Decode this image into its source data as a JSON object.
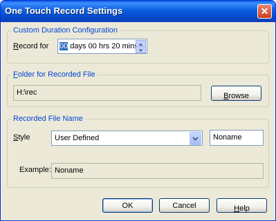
{
  "window": {
    "title": "One Touch Record Settings"
  },
  "duration_group": {
    "legend": "Custom Duration Configuration",
    "record_label_prefix": "R",
    "record_label_rest": "ecord for",
    "value_selected": "00",
    "value_rest": " days 00 hrs 20 mins"
  },
  "folder_group": {
    "legend_prefix": "F",
    "legend_rest": "older for Recorded File",
    "path": "H:\\rec",
    "browse_prefix": "B",
    "browse_rest": "rowse"
  },
  "filename_group": {
    "legend": "Recorded File Name",
    "style_label_prefix": "S",
    "style_label_rest": "tyle",
    "style_value": "User Defined",
    "name_value": "Noname",
    "example_label": "Example:",
    "example_value": "Noname"
  },
  "buttons": {
    "ok": "OK",
    "cancel": "Cancel",
    "help_prefix": "H",
    "help_rest": "elp"
  },
  "colors": {
    "title_bar": "#0a5fe0",
    "group_legend": "#0046d5",
    "dialog_bg": "#ece9d8"
  },
  "icons": [
    "close-icon",
    "spin-up-icon",
    "spin-down-icon",
    "dropdown-arrow-icon"
  ]
}
